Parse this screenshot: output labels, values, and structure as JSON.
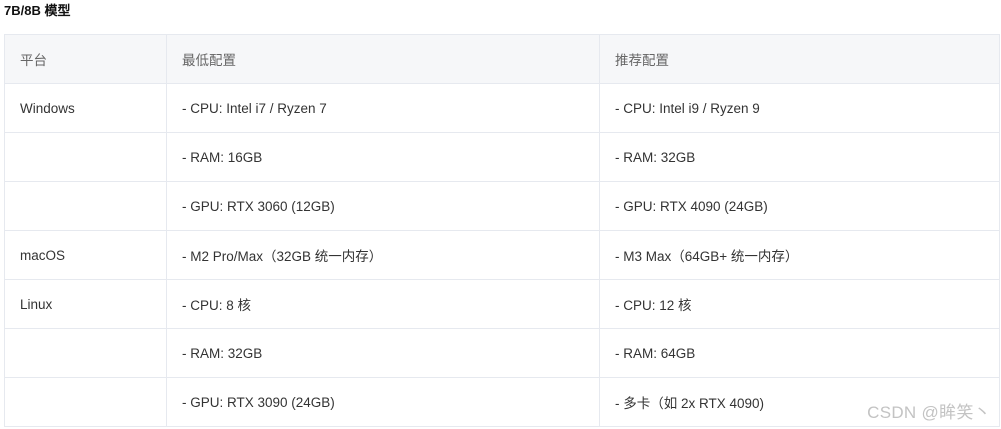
{
  "heading": "7B/8B 模型",
  "table": {
    "headers": [
      "平台",
      "最低配置",
      "推荐配置"
    ],
    "rows": [
      [
        "Windows",
        "- CPU: Intel i7 / Ryzen 7",
        "- CPU: Intel i9 / Ryzen 9"
      ],
      [
        "",
        "- RAM: 16GB",
        "- RAM: 32GB"
      ],
      [
        "",
        "- GPU: RTX 3060 (12GB)",
        "- GPU: RTX 4090 (24GB)"
      ],
      [
        "macOS",
        "- M2 Pro/Max（32GB 统一内存）",
        "- M3 Max（64GB+ 统一内存）"
      ],
      [
        "Linux",
        "- CPU: 8 核",
        "- CPU: 12 核"
      ],
      [
        "",
        "- RAM: 32GB",
        "- RAM: 64GB"
      ],
      [
        "",
        "- GPU: RTX 3090 (24GB)",
        "- 多卡（如 2x RTX 4090)"
      ]
    ]
  },
  "watermark": "CSDN @眸笑丶"
}
